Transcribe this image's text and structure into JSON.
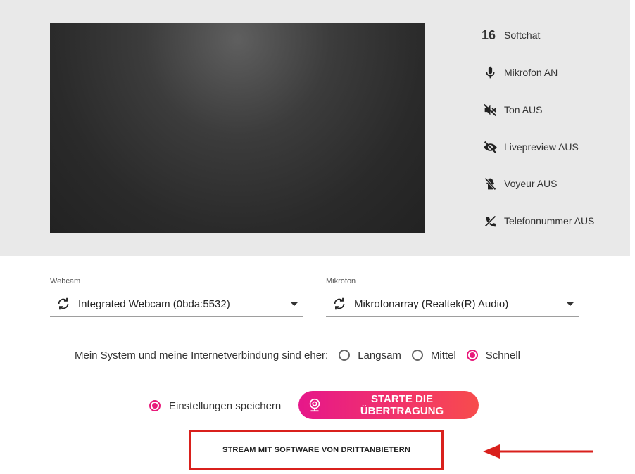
{
  "status": {
    "softchat_count": "16",
    "softchat_label": "Softchat",
    "microphone": "Mikrofon AN",
    "sound": "Ton AUS",
    "livepreview": "Livepreview AUS",
    "voyeur": "Voyeur AUS",
    "phone": "Telefonnummer AUS"
  },
  "webcam": {
    "label": "Webcam",
    "value": "Integrated Webcam (0bda:5532)"
  },
  "mikrofon": {
    "label": "Mikrofon",
    "value": "Mikrofonarray (Realtek(R) Audio)"
  },
  "speed": {
    "question": "Mein System und meine Internetverbindung sind eher:",
    "options": [
      "Langsam",
      "Mittel",
      "Schnell"
    ],
    "selected": "Schnell"
  },
  "save_settings": "Einstellungen speichern",
  "start_button": "STARTE DIE ÜBERTRAGUNG",
  "third_party_button": "STREAM MIT SOFTWARE VON DRITTANBIETERN",
  "colors": {
    "accent": "#e8197a",
    "panel": "#e9e9e9",
    "annotation": "#d9201c"
  },
  "icons": [
    "mic-icon",
    "sound-off-icon",
    "eye-off-icon",
    "voyeur-off-icon",
    "phone-off-icon",
    "sync-icon",
    "webcam-icon",
    "arrow-icon"
  ]
}
